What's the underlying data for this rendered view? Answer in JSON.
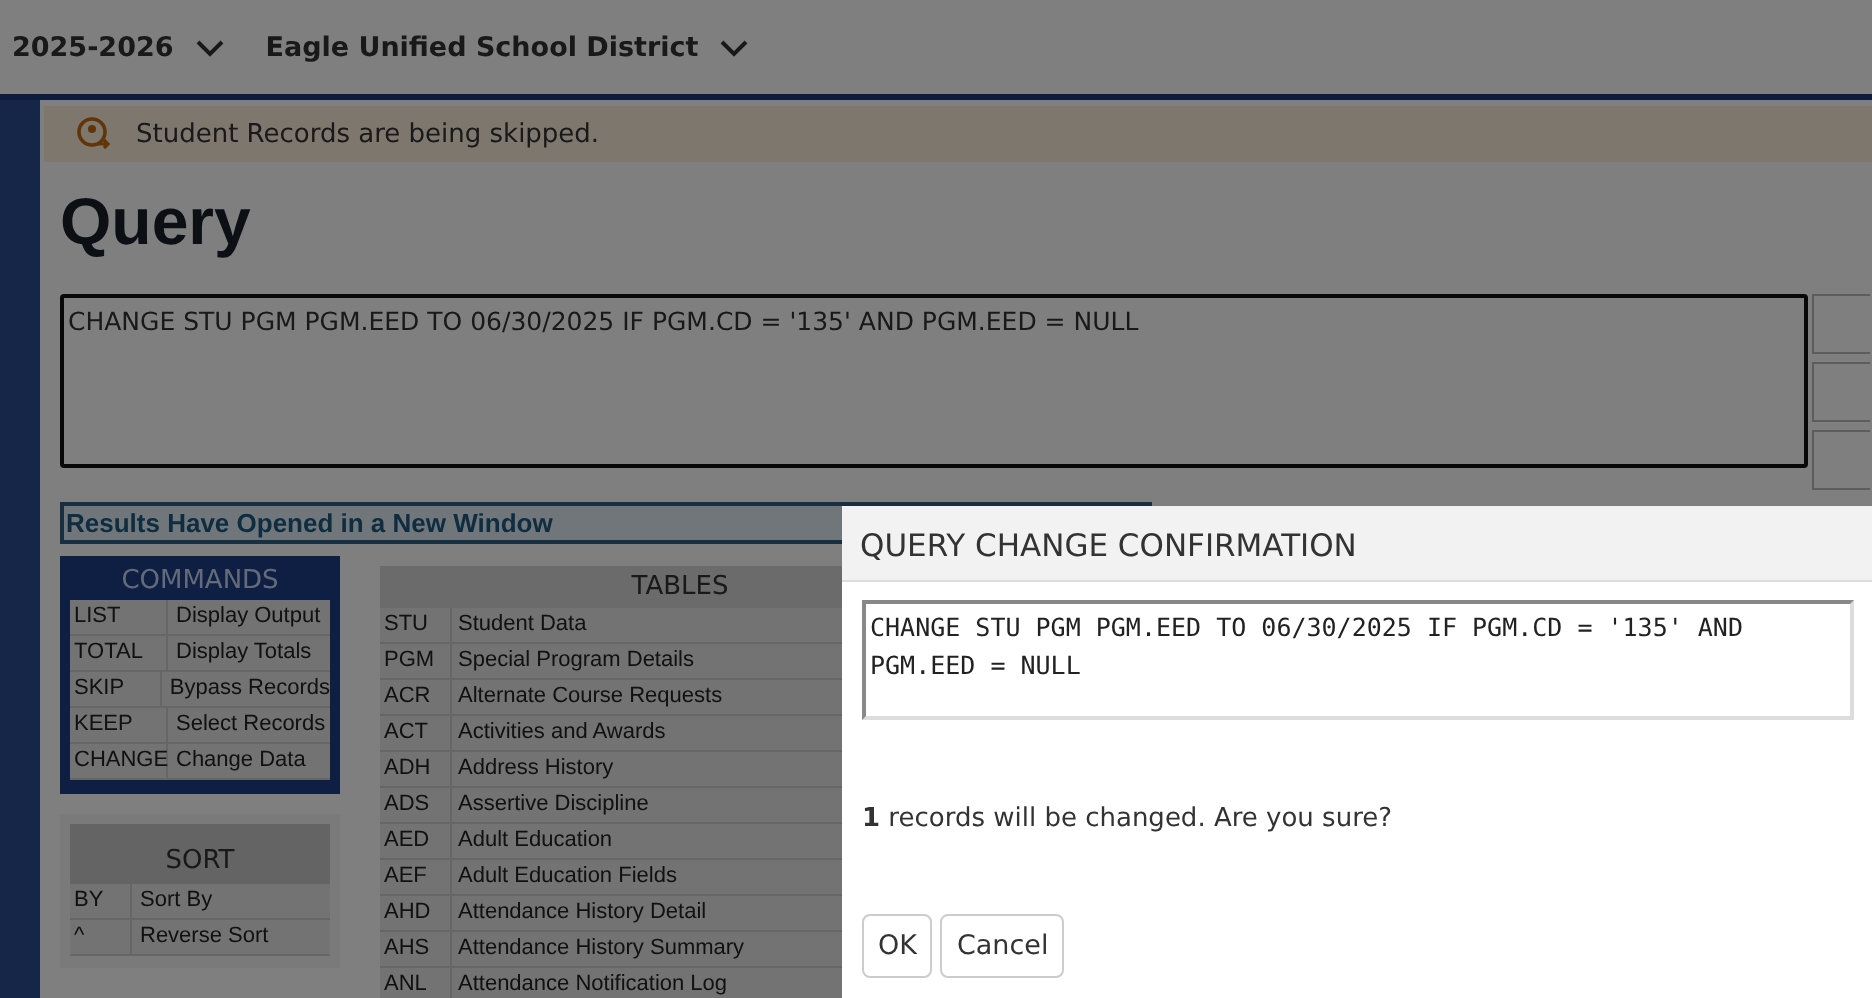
{
  "top_bar": {
    "school_year": "2025-2026",
    "district": "Eagle Unified School District"
  },
  "banner": {
    "message": "Student Records are being skipped."
  },
  "page_title": "Query",
  "query_text": "CHANGE STU PGM PGM.EED TO 06/30/2025 IF PGM.CD = '135' AND PGM.EED = NULL",
  "results_notice": "Results Have Opened in a New Window",
  "commands": {
    "title": "COMMANDS",
    "rows": [
      {
        "code": "LIST",
        "description": "Display Output"
      },
      {
        "code": "TOTAL",
        "description": "Display Totals"
      },
      {
        "code": "SKIP",
        "description": "Bypass Records"
      },
      {
        "code": "KEEP",
        "description": "Select Records"
      },
      {
        "code": "CHANGE",
        "description": "Change Data"
      }
    ]
  },
  "sort": {
    "title": "SORT",
    "rows": [
      {
        "code": "BY",
        "description": "Sort By"
      },
      {
        "code": "^",
        "description": "Reverse Sort"
      }
    ]
  },
  "tables": {
    "title": "TABLES",
    "rows": [
      {
        "code": "STU",
        "description": "Student Data"
      },
      {
        "code": "PGM",
        "description": "Special Program Details"
      },
      {
        "code": "ACR",
        "description": "Alternate Course Requests"
      },
      {
        "code": "ACT",
        "description": "Activities and Awards"
      },
      {
        "code": "ADH",
        "description": "Address History"
      },
      {
        "code": "ADS",
        "description": "Assertive Discipline"
      },
      {
        "code": "AED",
        "description": "Adult Education"
      },
      {
        "code": "AEF",
        "description": "Adult Education Fields"
      },
      {
        "code": "AHD",
        "description": "Attendance History Detail"
      },
      {
        "code": "AHS",
        "description": "Attendance History Summary"
      },
      {
        "code": "ANL",
        "description": "Attendance Notification Log"
      }
    ]
  },
  "dialog": {
    "title": "QUERY CHANGE CONFIRMATION",
    "query_text": "CHANGE STU PGM PGM.EED TO 06/30/2025 IF PGM.CD = '135' AND PGM.EED = NULL",
    "message": "**1** records will be changed. Are you sure?",
    "buttons": [
      "OK",
      "Cancel"
    ]
  }
}
